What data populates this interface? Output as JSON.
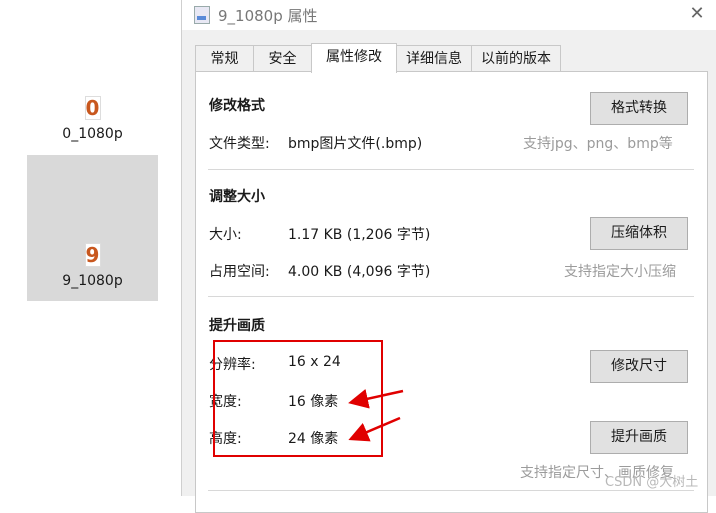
{
  "explorer": {
    "files": [
      {
        "name": "0_1080p",
        "glyph": "0",
        "selected": false
      },
      {
        "name": "9_1080p",
        "glyph": "9",
        "selected": true
      }
    ]
  },
  "dialog": {
    "title": "9_1080p 属性",
    "close_glyph": "✕",
    "tabs": [
      "常规",
      "安全",
      "属性修改",
      "详细信息",
      "以前的版本"
    ],
    "active_tab": "属性修改",
    "format": {
      "heading": "修改格式",
      "type_label": "文件类型:",
      "type_value": "bmp图片文件(.bmp)",
      "button": "格式转换",
      "hint": "支持jpg、png、bmp等"
    },
    "size": {
      "heading": "调整大小",
      "size_label": "大小:",
      "size_value": "1.17 KB (1,206 字节)",
      "disk_label": "占用空间:",
      "disk_value": "4.00 KB (4,096 字节)",
      "button": "压缩体积",
      "hint": "支持指定大小压缩"
    },
    "quality": {
      "heading": "提升画质",
      "resolution_label": "分辨率:",
      "resolution_value": "16 x 24",
      "width_label": "宽度:",
      "width_value": "16 像素",
      "height_label": "高度:",
      "height_value": "24 像素",
      "resize_button": "修改尺寸",
      "enhance_button": "提升画质",
      "hint": "支持指定尺寸、画质修复"
    }
  },
  "annotation_color": "#e00000",
  "watermark": "CSDN @大树土"
}
